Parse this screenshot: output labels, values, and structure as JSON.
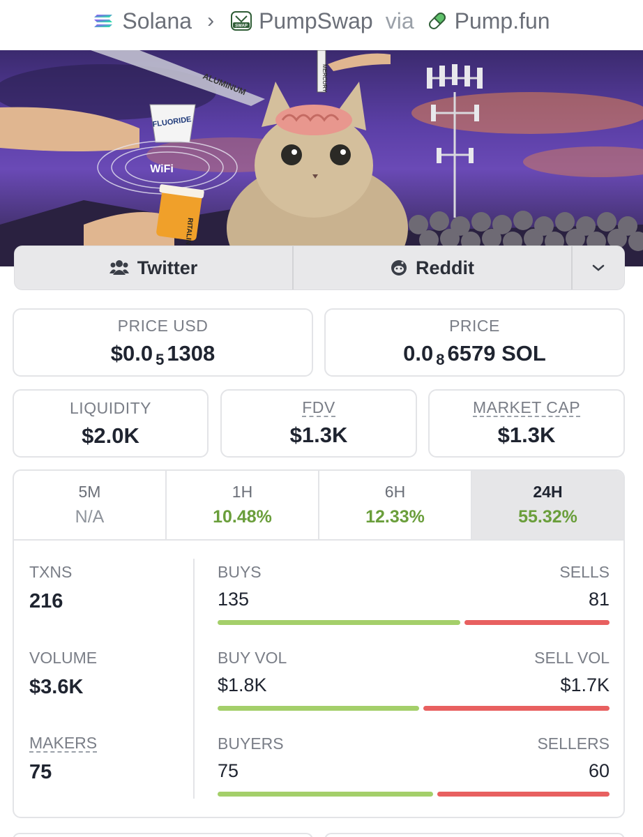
{
  "breadcrumb": {
    "chain": "Solana",
    "dex": "PumpSwap",
    "via": "via",
    "launchpad": "Pump.fun"
  },
  "banner": {
    "labels": [
      "ALUMINUM",
      "MERCURY",
      "FLUORIDE",
      "WiFi",
      "RITALIN"
    ]
  },
  "social": {
    "twitter": "Twitter",
    "reddit": "Reddit"
  },
  "price_usd": {
    "label": "PRICE USD",
    "prefix": "$0.0",
    "zeros": "5",
    "digits": "1308"
  },
  "price_sol": {
    "label": "PRICE",
    "prefix": "0.0",
    "zeros": "8",
    "digits": "6579 SOL"
  },
  "liquidity": {
    "label": "LIQUIDITY",
    "value": "$2.0K"
  },
  "fdv": {
    "label": "FDV",
    "value": "$1.3K"
  },
  "market_cap": {
    "label": "MARKET CAP",
    "value": "$1.3K"
  },
  "timeframes": [
    {
      "label": "5M",
      "value": "N/A"
    },
    {
      "label": "1H",
      "value": "10.48%"
    },
    {
      "label": "6H",
      "value": "12.33%"
    },
    {
      "label": "24H",
      "value": "55.32%"
    }
  ],
  "txns": {
    "label": "TXNS",
    "value": "216",
    "buys_label": "BUYS",
    "buys": "135",
    "sells_label": "SELLS",
    "sells": "81",
    "buy_fraction": 0.625
  },
  "volume": {
    "label": "VOLUME",
    "value": "$3.6K",
    "buy_label": "BUY VOL",
    "buy": "$1.8K",
    "sell_label": "SELL VOL",
    "sell": "$1.7K",
    "buy_fraction": 0.52
  },
  "makers": {
    "label": "MAKERS",
    "value": "75",
    "buyers_label": "BUYERS",
    "buyers": "75",
    "sellers_label": "SELLERS",
    "sellers": "60",
    "buy_fraction": 0.556
  },
  "colors": {
    "positive": "#6a9e3b",
    "buy_bar": "#a4cf6a",
    "sell_bar": "#e86060"
  }
}
